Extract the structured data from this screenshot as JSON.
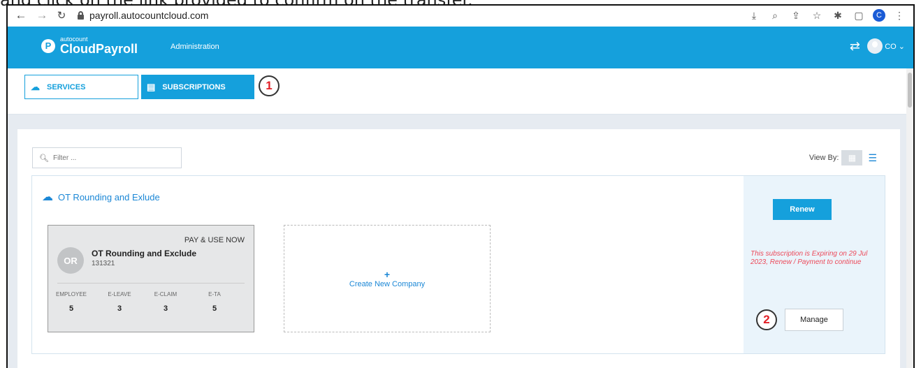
{
  "caption": "and click on the link provided to confirm on the transfer.",
  "browser": {
    "url": "payroll.autocountcloud.com",
    "profile_initial": "C"
  },
  "app": {
    "logo_small": "autocount",
    "logo_big": "CloudPayroll",
    "logo_badge": "P",
    "nav_admin": "Administration",
    "user_code": "CO"
  },
  "tabs": {
    "services": "SERVICES",
    "subscriptions": "SUBSCRIPTIONS"
  },
  "markers": {
    "one": "1",
    "two": "2"
  },
  "filter": {
    "placeholder": "Filter ..."
  },
  "view_by": {
    "label": "View By:"
  },
  "service": {
    "title": "OT Rounding and Exlude",
    "company": {
      "plan": "PAY & USE NOW",
      "initials": "OR",
      "name": "OT Rounding and Exclude",
      "code": "131321",
      "stats": [
        {
          "label": "EMPLOYEE",
          "value": "5"
        },
        {
          "label": "E-LEAVE",
          "value": "3"
        },
        {
          "label": "E-CLAIM",
          "value": "3"
        },
        {
          "label": "E-TA",
          "value": "5"
        }
      ]
    },
    "create": {
      "plus": "+",
      "label": "Create New Company"
    },
    "renew_label": "Renew",
    "expire_message": "This subscription is Expiring on 29 Jul 2023, Renew / Payment to continue",
    "manage_label": "Manage"
  },
  "colors": {
    "brand": "#15a0dc",
    "link": "#1b87d6",
    "warning": "#ec4a5a"
  }
}
